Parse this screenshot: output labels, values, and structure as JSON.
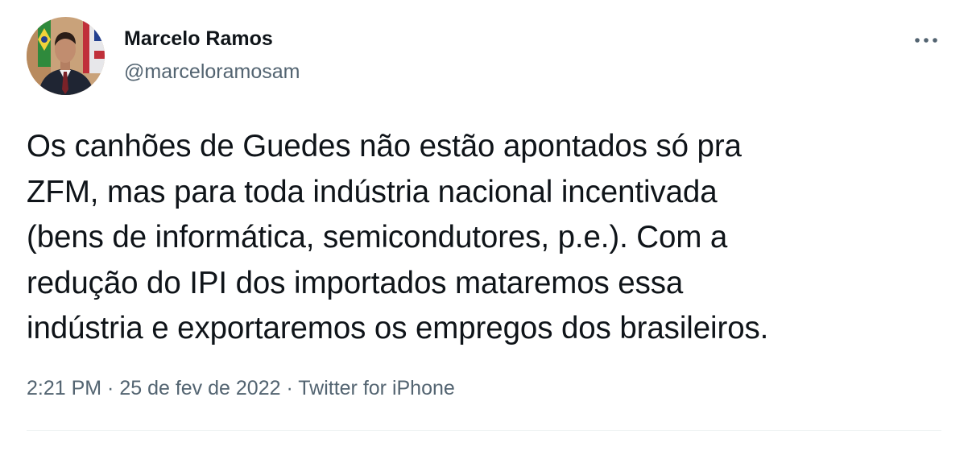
{
  "author": {
    "display_name": "Marcelo Ramos",
    "handle": "@marceloramosam"
  },
  "tweet": {
    "lines": [
      "Os canhões de Guedes não estão apontados só pra",
      "ZFM, mas para toda indústria nacional incentivada",
      "(bens de informática, semicondutores, p.e.). Com a",
      "redução do IPI dos importados mataremos essa",
      "indústria e exportaremos os empregos dos brasileiros."
    ]
  },
  "meta": {
    "time": "2:21 PM",
    "separator": " · ",
    "date": "25 de fev de 2022",
    "source": "Twitter for iPhone"
  },
  "colors": {
    "text": "#0f1419",
    "secondary": "#536471",
    "divider": "#eff3f4"
  },
  "icons": {
    "more": "more-horizontal-icon"
  }
}
